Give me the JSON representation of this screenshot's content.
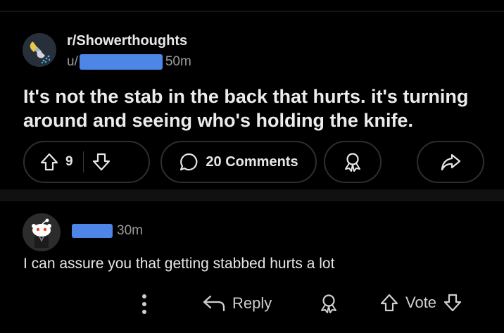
{
  "post": {
    "subreddit": "r/Showerthoughts",
    "user_prefix": "u/",
    "age": "50m",
    "title": "It's not the stab in the back that hurts. it's turning around and seeing who's holding the knife.",
    "upvotes": "9",
    "comments_label": "20 Comments"
  },
  "comment": {
    "age": "30m",
    "body": "I can assure you that getting stabbed hurts a lot",
    "reply_label": "Reply",
    "vote_label": "Vote"
  },
  "colors": {
    "background": "#000000",
    "redaction": "#4e86e8",
    "pill_border": "#2e2e2e"
  },
  "icons": [
    "showerhead-lightbulb-icon",
    "upvote-icon",
    "downvote-icon",
    "comment-bubble-icon",
    "award-icon",
    "share-icon",
    "snoo-avatar-icon",
    "more-options-icon",
    "reply-icon"
  ]
}
